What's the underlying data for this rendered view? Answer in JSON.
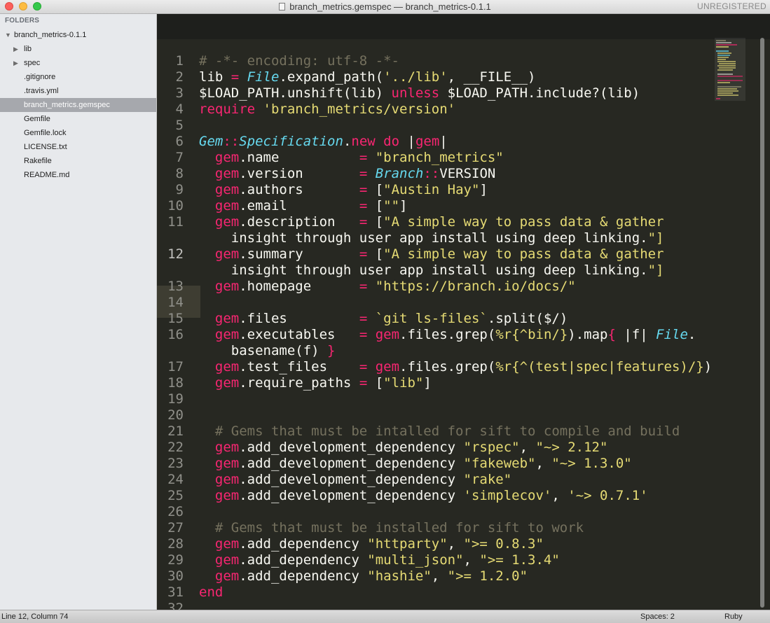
{
  "window": {
    "title": "branch_metrics.gemspec — branch_metrics-0.1.1",
    "registration": "UNREGISTERED"
  },
  "sidebar": {
    "header": "FOLDERS",
    "root": "branch_metrics-0.1.1",
    "items": [
      {
        "label": "lib",
        "type": "folder"
      },
      {
        "label": "spec",
        "type": "folder"
      },
      {
        "label": ".gitignore",
        "type": "file"
      },
      {
        "label": ".travis.yml",
        "type": "file"
      },
      {
        "label": "branch_metrics.gemspec",
        "type": "file",
        "selected": true
      },
      {
        "label": "Gemfile",
        "type": "file"
      },
      {
        "label": "Gemfile.lock",
        "type": "file"
      },
      {
        "label": "LICENSE.txt",
        "type": "file"
      },
      {
        "label": "Rakefile",
        "type": "file"
      },
      {
        "label": "README.md",
        "type": "file"
      }
    ]
  },
  "editor": {
    "current_line": 12,
    "line_numbers": [
      "1",
      "2",
      "3",
      "4",
      "5",
      "6",
      "7",
      "8",
      "9",
      "10",
      "11",
      "12",
      "13",
      "14",
      "15",
      "16",
      "17",
      "18",
      "19",
      "20",
      "21",
      "22",
      "23",
      "24",
      "25",
      "26",
      "27",
      "28",
      "29",
      "30",
      "31",
      "32"
    ],
    "code_lines": [
      "# -*- encoding: utf-8 -*-",
      "lib = File.expand_path('../lib', __FILE__)",
      "$LOAD_PATH.unshift(lib) unless $LOAD_PATH.include?(lib)",
      "require 'branch_metrics/version'",
      "",
      "Gem::Specification.new do |gem|",
      "  gem.name          = \"branch_metrics\"",
      "  gem.version       = Branch::VERSION",
      "  gem.authors       = [\"Austin Hay\"]",
      "  gem.email         = [\"\"]",
      "  gem.description   = [\"A simple way to pass data & gather",
      "    insight through user app install using deep linking.\"]",
      "  gem.summary       = [\"A simple way to pass data & gather",
      "    insight through user app install using deep linking.\"]",
      "  gem.homepage      = \"https://branch.io/docs/\"",
      "",
      "  gem.files         = `git ls-files`.split($/)",
      "  gem.executables   = gem.files.grep(%r{^bin/}).map{ |f| File.",
      "    basename(f) }",
      "  gem.test_files    = gem.files.grep(%r{^(test|spec|features)/})",
      "  gem.require_paths = [\"lib\"]",
      "",
      "",
      "  # Gems that must be intalled for sift to compile and build",
      "  gem.add_development_dependency \"rspec\", \"~> 2.12\"",
      "  gem.add_development_dependency \"fakeweb\", \"~> 1.3.0\"",
      "  gem.add_development_dependency \"rake\"",
      "  gem.add_development_dependency 'simplecov', '~> 0.7.1'",
      "",
      "  # Gems that must be installed for sift to work",
      "  gem.add_dependency \"httparty\", \">= 0.8.3\"",
      "  gem.add_dependency \"multi_json\", \">= 1.3.4\"",
      "  gem.add_dependency \"hashie\", \">= 1.2.0\"",
      "end",
      ""
    ]
  },
  "colors": {
    "background": "#272822",
    "foreground": "#f8f8f2",
    "comment": "#75715e",
    "keyword": "#f92672",
    "string": "#e6db74",
    "constant": "#66d9ef",
    "number": "#ae81ff"
  },
  "statusbar": {
    "position": "Line 12, Column 74",
    "spaces": "Spaces: 2",
    "syntax": "Ruby"
  }
}
